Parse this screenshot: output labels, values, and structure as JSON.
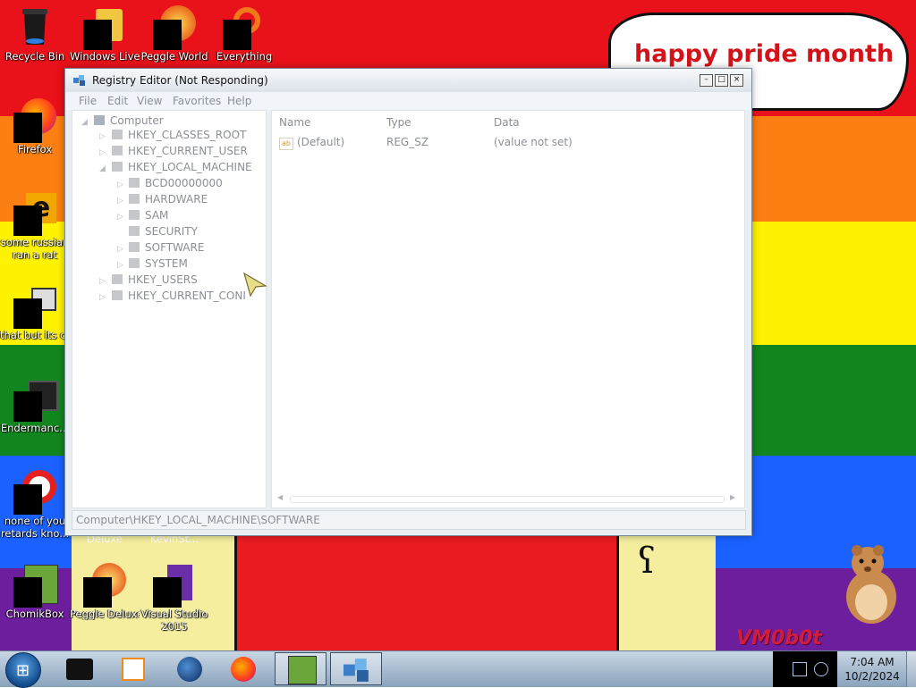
{
  "desktop": {
    "speech_text": "happy pride month",
    "watermark": "VM0b0t",
    "icons": [
      {
        "label": "Recycle Bin"
      },
      {
        "label": "Windows Live"
      },
      {
        "label": "Peggle World"
      },
      {
        "label": "Everything"
      },
      {
        "label": "Firefox"
      },
      {
        "label": "some russian"
      },
      {
        "label": "ran a rat"
      },
      {
        "label": "that but its c..."
      },
      {
        "label": "Endermanc..."
      },
      {
        "label": "none of you"
      },
      {
        "label": "retards kno..."
      },
      {
        "label": "Deluxe"
      },
      {
        "label": "KevinSt..."
      },
      {
        "label": "ChomikBox"
      },
      {
        "label": "Peggle Deluxe"
      },
      {
        "label": "Visual Studio"
      },
      {
        "label": "2015"
      }
    ]
  },
  "window": {
    "title": "Registry Editor (Not Responding)",
    "menu": [
      "File",
      "Edit",
      "View",
      "Favorites",
      "Help"
    ],
    "tree": {
      "root": "Computer",
      "items": [
        "HKEY_CLASSES_ROOT",
        "HKEY_CURRENT_USER",
        "HKEY_LOCAL_MACHINE",
        "BCD00000000",
        "HARDWARE",
        "SAM",
        "SECURITY",
        "SOFTWARE",
        "SYSTEM",
        "HKEY_USERS",
        "HKEY_CURRENT_CONI"
      ]
    },
    "list": {
      "columns": [
        "Name",
        "Type",
        "Data"
      ],
      "rows": [
        {
          "icon": "ab",
          "name": "(Default)",
          "type": "REG_SZ",
          "data": "(value not set)"
        }
      ]
    },
    "status": "Computer\\HKEY_LOCAL_MACHINE\\SOFTWARE"
  },
  "taskbar": {
    "start_glyph": "⊞",
    "time": "7:04 AM",
    "date": "10/2/2024"
  },
  "colors": {
    "speech_text": "#d4121a",
    "wallpaper_red": "#e9111a",
    "wallpaper_purple": "#6c1e9c"
  }
}
